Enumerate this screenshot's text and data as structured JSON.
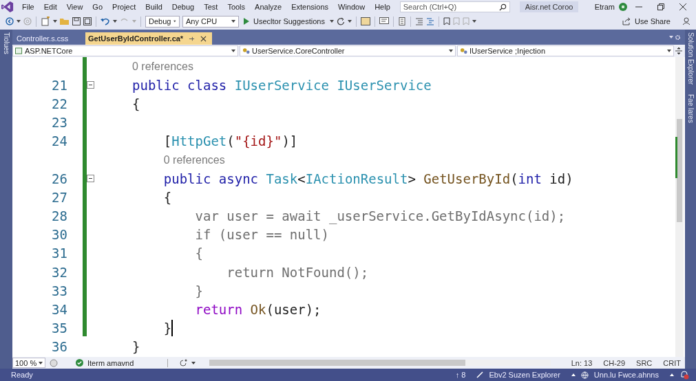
{
  "menu": [
    "File",
    "Edit",
    "View",
    "Go",
    "Project",
    "Build",
    "Debug",
    "Test",
    "Tools",
    "Analyze",
    "Extensions",
    "Window",
    "Help"
  ],
  "search": {
    "placeholder": "Search (Ctrl+Q)"
  },
  "solution_name": "Aisr.net Coroo",
  "user": {
    "name": "Etram"
  },
  "toolbar": {
    "configuration": "Debug",
    "platform": "Any CPU",
    "run_target": "Usecltor Suggestions",
    "share": "Use Share"
  },
  "left_panel": {
    "label": "Tiolues"
  },
  "right_panel": {
    "labels": [
      "Solution Explorer",
      "Fae lares"
    ]
  },
  "tabs": [
    {
      "label": "Controller.s.css",
      "selected": false
    },
    {
      "label": "GetUserByIdController.ca*",
      "selected": true
    }
  ],
  "navigation": [
    "ASP.NETCore",
    "UserService.CoreController",
    "IUserService ;Injection"
  ],
  "code": [
    {
      "kind": "codelens",
      "text": "0 references"
    },
    {
      "kind": "code",
      "number": "21",
      "fold": true,
      "caret": false,
      "tokens": [
        {
          "text": "public class ",
          "kind": "keyword"
        },
        {
          "text": "IUserService IUserService",
          "kind": "type"
        }
      ]
    },
    {
      "kind": "code",
      "number": "22",
      "fold": false,
      "caret": false,
      "tokens": [
        {
          "text": "{",
          "kind": "plain"
        }
      ]
    },
    {
      "kind": "code",
      "number": "23",
      "fold": false,
      "caret": false
    },
    {
      "kind": "code",
      "number": "24",
      "fold": false,
      "caret": false,
      "tokens": [
        {
          "text": "    [",
          "kind": "plain"
        },
        {
          "text": "HttpGet",
          "kind": "type"
        },
        {
          "text": "(",
          "kind": "plain"
        },
        {
          "text": "\"{id}\"",
          "kind": "string"
        },
        {
          "text": ")]",
          "kind": "plain"
        }
      ]
    },
    {
      "kind": "codelens",
      "text": "0 references"
    },
    {
      "kind": "code",
      "number": "26",
      "fold": true,
      "caret": false,
      "tokens": [
        {
          "text": "    public async ",
          "kind": "keyword"
        },
        {
          "text": "Task",
          "kind": "type"
        },
        {
          "text": "<",
          "kind": "plain"
        },
        {
          "text": "IActionResult",
          "kind": "type"
        },
        {
          "text": "> ",
          "kind": "plain"
        },
        {
          "text": "GetUserById",
          "kind": "method"
        },
        {
          "text": "(",
          "kind": "plain"
        },
        {
          "text": "int",
          "kind": "keyword"
        },
        {
          "text": " id)",
          "kind": "plain"
        }
      ]
    },
    {
      "kind": "code",
      "number": "27",
      "fold": false,
      "caret": false,
      "tokens": [
        {
          "text": "    {",
          "kind": "plain"
        }
      ]
    },
    {
      "kind": "code",
      "number": "28",
      "fold": false,
      "caret": false,
      "tokens": [
        {
          "text": "        var user = await _userService.GetByIdAsync(id);",
          "kind": "dim"
        }
      ]
    },
    {
      "kind": "code",
      "number": "30",
      "fold": false,
      "caret": false,
      "tokens": [
        {
          "text": "        if (user == null)",
          "kind": "dim"
        }
      ]
    },
    {
      "kind": "code",
      "number": "31",
      "fold": false,
      "caret": false,
      "tokens": [
        {
          "text": "        {",
          "kind": "dim"
        }
      ]
    },
    {
      "kind": "code",
      "number": "32",
      "fold": false,
      "caret": false,
      "tokens": [
        {
          "text": "            return NotFound();",
          "kind": "dim"
        }
      ]
    },
    {
      "kind": "code",
      "number": "33",
      "fold": false,
      "caret": false,
      "tokens": [
        {
          "text": "        }",
          "kind": "dim"
        }
      ]
    },
    {
      "kind": "code",
      "number": "34",
      "fold": false,
      "caret": false,
      "tokens": [
        {
          "text": "        return ",
          "kind": "control"
        },
        {
          "text": "Ok",
          "kind": "method"
        },
        {
          "text": "(user);",
          "kind": "plain"
        }
      ]
    },
    {
      "kind": "code",
      "number": "35",
      "fold": false,
      "caret": true,
      "tokens": [
        {
          "text": "    }",
          "kind": "plain"
        }
      ]
    },
    {
      "kind": "code",
      "number": "36",
      "fold": false,
      "caret": false,
      "tokens": [
        {
          "text": "}",
          "kind": "plain"
        }
      ]
    }
  ],
  "editor_bar": {
    "zoom": "100 %",
    "health": "Iterm amavnd",
    "line": "Ln: 13",
    "column": "CH-29",
    "encoding": "SRC",
    "line_ending": "CRIT"
  },
  "status_bar": {
    "state": "Ready",
    "push_count": "↑ 8",
    "repository": "Ebv2 Suzen Explorer",
    "branch": "Unn.lu Fwce.ahnns"
  }
}
